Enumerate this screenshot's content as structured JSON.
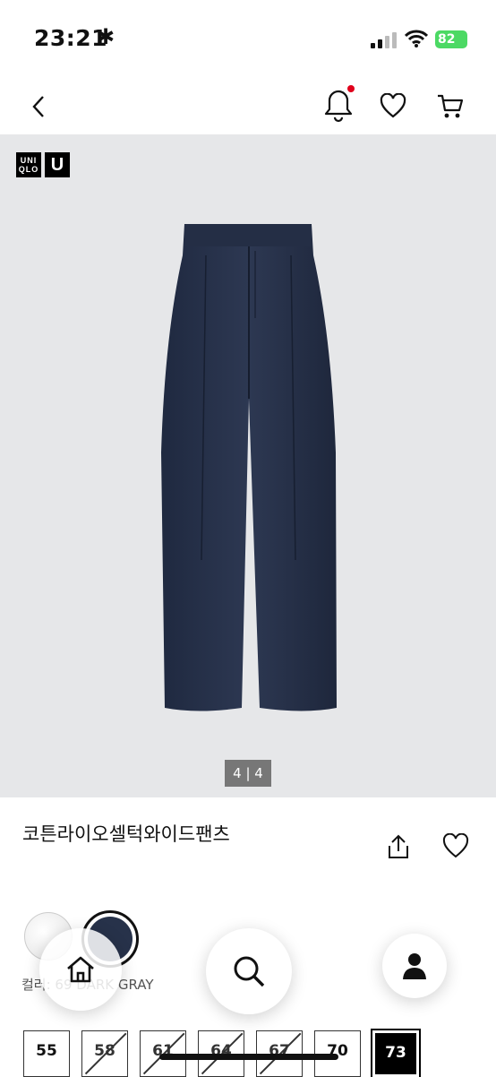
{
  "status": {
    "time": "23:21",
    "time_icon": "asterisk",
    "battery": "82"
  },
  "nav": {
    "back_icon": "chevron-left-icon",
    "notification_icon": "bell-icon",
    "wishlist_icon": "heart-icon",
    "cart_icon": "cart-icon"
  },
  "brand": {
    "logo_line1": "UNI",
    "logo_line2": "QLO",
    "logo_u": "U"
  },
  "gallery": {
    "counter": "4 | 4"
  },
  "product": {
    "name": "코튼라이오셀턱와이드팬츠",
    "color_label": "컬러: 69 DARK GRAY"
  },
  "colors": {
    "accent": "#27324a",
    "notification_dot": "#e0001b",
    "battery": "#4cd964"
  },
  "sizes": [
    {
      "label": "55",
      "disabled": false
    },
    {
      "label": "58",
      "disabled": true
    },
    {
      "label": "61",
      "disabled": true
    },
    {
      "label": "64",
      "disabled": true
    },
    {
      "label": "67",
      "disabled": true
    },
    {
      "label": "70",
      "disabled": false
    },
    {
      "label": "73",
      "selected": true
    }
  ]
}
